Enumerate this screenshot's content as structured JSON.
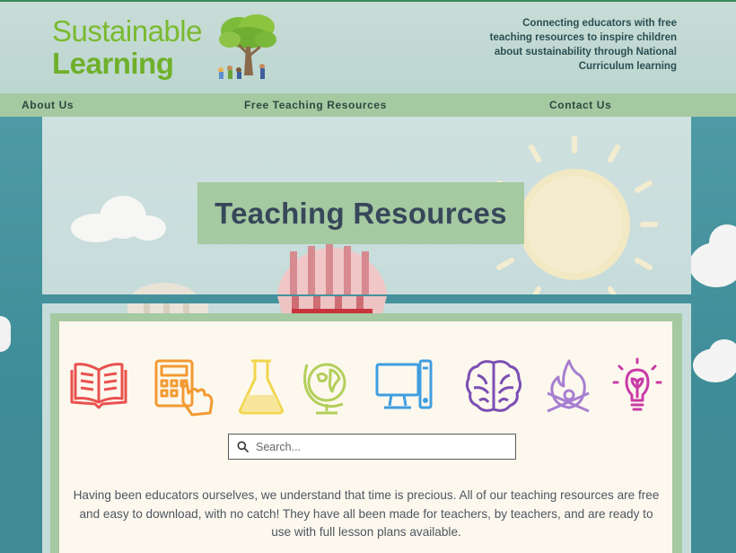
{
  "header": {
    "logo_line1": "Sustainable",
    "logo_line2": "Learning",
    "tagline": "Connecting educators with free teaching resources to inspire children about sustainability through National Curriculum learning"
  },
  "nav": {
    "items": [
      {
        "label": "About Us"
      },
      {
        "label": "Free Teaching Resources"
      },
      {
        "label": "Contact Us"
      }
    ]
  },
  "hero": {
    "title": "Teaching Resources"
  },
  "subjects": [
    {
      "icon": "open-book-icon",
      "color": "#e8524f"
    },
    {
      "icon": "calculator-icon",
      "color": "#f29a32"
    },
    {
      "icon": "flask-icon",
      "color": "#f1d54d"
    },
    {
      "icon": "globe-icon",
      "color": "#b3cf5a"
    },
    {
      "icon": "computer-icon",
      "color": "#3f9ee0"
    },
    {
      "icon": "brain-icon",
      "color": "#7b4fb3"
    },
    {
      "icon": "campfire-icon",
      "color": "#a77fd1"
    },
    {
      "icon": "lightbulb-icon",
      "color": "#c93aa6"
    }
  ],
  "search": {
    "placeholder": "Search..."
  },
  "intro": {
    "text": "Having been educators ourselves, we understand that time is precious. All of our teaching resources are free and easy to download, with no catch! They have all been made for teachers, by teachers, and are ready to use with full lesson plans available."
  },
  "colors": {
    "brand_green": "#7fba2e",
    "nav_green": "#a5c9a1",
    "sky_teal": "#4e9aa3",
    "card_cream": "#fdf8ee"
  }
}
